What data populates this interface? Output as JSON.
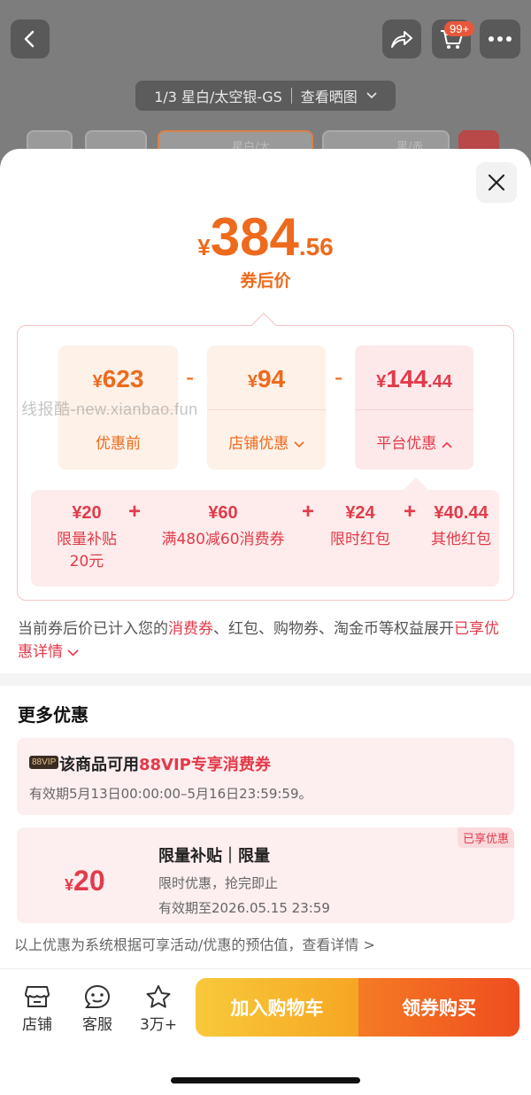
{
  "top": {
    "cart_badge": "99+",
    "sku_text": "1/3 星白/太空银-GS",
    "view_image": "查看晒图",
    "thumbs": [
      {
        "label": "星白/太"
      },
      {
        "label": "黑/赤..."
      }
    ]
  },
  "price": {
    "yen": "¥",
    "int": "384",
    "dec": ".56",
    "label": "券后价"
  },
  "calc": {
    "cards": [
      {
        "yen": "¥",
        "int": "623",
        "dec": "",
        "name": "优惠前"
      },
      {
        "yen": "¥",
        "int": "94",
        "dec": "",
        "name": "店铺优惠"
      },
      {
        "yen": "¥",
        "int": "144",
        "dec": ".44",
        "name": "平台优惠"
      }
    ],
    "minus": "-",
    "plus": "+",
    "sub_items": [
      {
        "value": "¥20",
        "name": "限量补贴",
        "name2": "20元"
      },
      {
        "value": "¥60",
        "name": "满480减60消费券"
      },
      {
        "value": "¥24",
        "name": "限时红包"
      },
      {
        "value": "¥40.44",
        "name": "其他红包"
      }
    ]
  },
  "watermark": "线报酷-new.xianbao.fun",
  "note": {
    "part1": "当前券后价已计入您的",
    "hl1": "消费券",
    "part2": "、红包、购物券、淘金币等权益展开",
    "hl2": "已享优惠详情",
    "chev": "⌄"
  },
  "more": {
    "title": "更多优惠",
    "vip": {
      "tag": "88VIP",
      "title_pre": "该商品可用",
      "title_hl": "88VIP专享消费券",
      "date": "有效期5月13日00:00:00–5月16日23:59:59。"
    },
    "subsidy": {
      "badge": "已享优惠",
      "yen": "¥",
      "amount": "20",
      "title": "限量补贴｜限量",
      "line1": "限时优惠，抢完即止",
      "line2": "有效期至2026.05.15 23:59"
    },
    "footnote": "以上优惠为系统根据可享活动/优惠的预估值，查看详情 >"
  },
  "bottom": {
    "store": "店铺",
    "service": "客服",
    "fav": "3万+",
    "add_cart": "加入购物车",
    "buy": "领券购买"
  },
  "colors": {
    "orange": "#ee6a1c",
    "red": "#e33a4a",
    "cart_btn": "#f6a623",
    "buy_btn": "#ef4d1f"
  }
}
